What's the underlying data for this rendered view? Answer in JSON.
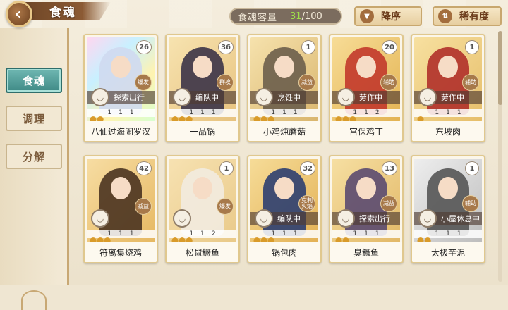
{
  "header": {
    "title": "食魂",
    "capacity_label": "食魂容量",
    "capacity_current": "31",
    "capacity_total": "/100",
    "sort_label": "降序",
    "rarity_label": "稀有度"
  },
  "sidebar": {
    "items": [
      {
        "label": "食魂",
        "active": true
      },
      {
        "label": "调理",
        "active": false
      },
      {
        "label": "分解",
        "active": false
      }
    ]
  },
  "cards": [
    {
      "name": "八仙过海闹罗汉",
      "level": "26",
      "badge": "爆发",
      "status": "探索出行",
      "s1": "1",
      "s2": "1",
      "s3": "1",
      "dots": "⬤⬤",
      "bg": "linear-gradient(135deg,#ffd7f0,#c8f0ff,#fff3b0,#d7ffd0)",
      "fig": "#cfd9f0"
    },
    {
      "name": "一品锅",
      "level": "36",
      "badge": "群攻",
      "status": "编队中",
      "s1": "1",
      "s2": "1",
      "s3": "1",
      "dots": "⬤⬤⬤",
      "bg": "linear-gradient(135deg,#f7e3b0,#e7c27e)",
      "fig": "#3b3347"
    },
    {
      "name": "小鸡炖蘑菇",
      "level": "1",
      "badge": "减益",
      "status": "烹饪中",
      "s1": "1",
      "s2": "1",
      "s3": "1",
      "dots": "⬤⬤⬤",
      "bg": "linear-gradient(135deg,#f6e2ad,#d9b56d)",
      "fig": "#6b5e4b"
    },
    {
      "name": "宫保鸡丁",
      "level": "20",
      "badge": "辅助",
      "status": "劳作中",
      "s1": "1",
      "s2": "1",
      "s3": "2",
      "dots": "⬤⬤⬤",
      "bg": "linear-gradient(135deg,#f7dc96,#e3b352)",
      "fig": "#c2392b"
    },
    {
      "name": "东坡肉",
      "level": "1",
      "badge": "辅助",
      "status": "劳作中",
      "s1": "1",
      "s2": "1",
      "s3": "1",
      "dots": "⬤",
      "bg": "linear-gradient(135deg,#f7e0a0,#e6be6a)",
      "fig": "#b0302a"
    },
    {
      "name": "符离集烧鸡",
      "level": "42",
      "badge": "减益",
      "status": "",
      "s1": "1",
      "s2": "1",
      "s3": "1",
      "dots": "⬤⬤⬤",
      "bg": "linear-gradient(135deg,#f7dda3,#e6b862)",
      "fig": "#4a3320"
    },
    {
      "name": "松鼠鳜鱼",
      "level": "1",
      "badge": "爆发",
      "status": "",
      "s1": "1",
      "s2": "1",
      "s3": "2",
      "dots": "⬤⬤⬤",
      "bg": "linear-gradient(135deg,#f7e2b2,#e9c988)",
      "fig": "#f2ebe0"
    },
    {
      "name": "锅包肉",
      "level": "32",
      "badge": "克制火焰",
      "status": "编队中",
      "s1": "1",
      "s2": "1",
      "s3": "1",
      "dots": "⬤⬤⬤",
      "bg": "linear-gradient(135deg,#f6dc98,#e3b155)",
      "fig": "#2c3e70"
    },
    {
      "name": "臭鳜鱼",
      "level": "13",
      "badge": "减益",
      "status": "探索出行",
      "s1": "1",
      "s2": "1",
      "s3": "1",
      "dots": "⬤⬤",
      "bg": "linear-gradient(135deg,#f6dfa2,#e2b867)",
      "fig": "#5b4a70"
    },
    {
      "name": "太极芋泥",
      "level": "1",
      "badge": "辅助",
      "status": "小屋休息中",
      "s1": "1",
      "s2": "1",
      "s3": "1",
      "dots": "⬤⬤",
      "bg": "linear-gradient(135deg,#eeeeee,#bdbdbd)",
      "fig": "#555555"
    }
  ]
}
